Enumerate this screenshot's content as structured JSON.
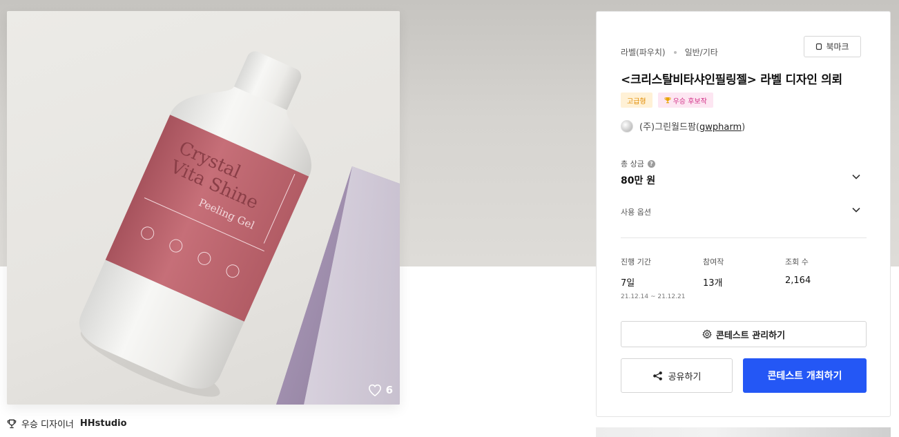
{
  "artwork": {
    "like_count": "6",
    "winner_prefix": "우승 디자이너",
    "winner_name": "HHstudio",
    "product_label_lines": [
      "Crystal",
      "Vita Shine",
      "Peeling Gel"
    ]
  },
  "contest": {
    "category_primary": "라벨(파우치)",
    "category_secondary": "일반/기타",
    "bookmark_label": "북마크",
    "title": "<크리스탈비타샤인필링젤> 라벨 디자인 의뢰",
    "badges": {
      "premium": "고급형",
      "candidate": "우승 후보작"
    },
    "host_name": "(주)그린월드팜",
    "host_id": "gwpharm",
    "prize_label": "총 상금",
    "prize_value": "80만 원",
    "options_label": "사용 옵션",
    "stats": {
      "period_label": "진행 기간",
      "period_value": "7일",
      "period_range": "21.12.14 ~ 21.12.21",
      "entries_label": "참여작",
      "entries_value": "13개",
      "views_label": "조회 수",
      "views_value": "2,164"
    },
    "manage_button": "콘테스트 관리하기",
    "share_button": "공유하기",
    "host_button": "콘테스트 개최하기"
  },
  "colors": {
    "primary_blue": "#2457f5",
    "premium_badge_text": "#e08a00",
    "candidate_badge_text": "#d12f86",
    "bottle_label": "#b8616a"
  },
  "icons": [
    "bookmark-icon",
    "trophy-icon",
    "heart-icon",
    "help-icon",
    "chevron-down-icon",
    "gear-icon",
    "share-icon"
  ]
}
